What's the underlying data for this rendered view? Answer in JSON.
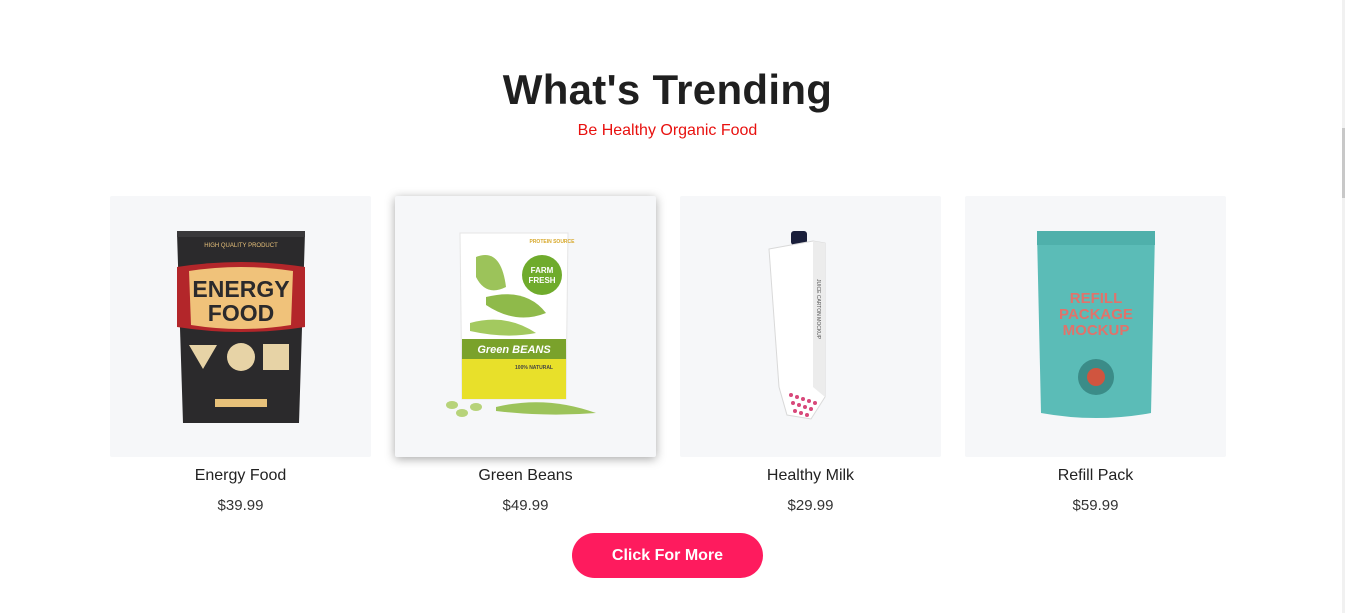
{
  "section": {
    "title": "What's Trending",
    "subtitle": "Be Healthy Organic Food"
  },
  "products": [
    {
      "name": "Energy Food",
      "price": "$39.99",
      "image_icon": "energy-food-pack-icon"
    },
    {
      "name": "Green Beans",
      "price": "$49.99",
      "image_icon": "green-beans-pouch-icon"
    },
    {
      "name": "Healthy Milk",
      "price": "$29.99",
      "image_icon": "milk-carton-icon"
    },
    {
      "name": "Refill Pack",
      "price": "$59.99",
      "image_icon": "refill-pouch-icon"
    }
  ],
  "packaging_text": {
    "energy_brand": "ENERGY",
    "energy_brand_2": "FOOD",
    "energy_tagline": "HIGH QUALITY PRODUCT",
    "beans_badge_1": "FARM",
    "beans_badge_2": "FRESH",
    "beans_label": "Green BEANS",
    "beans_natural": "100% NATURAL",
    "beans_protein": "PROTEIN SOURCE",
    "milk_side": "JUICE CARTON MOCKUP",
    "refill_1": "REFILL",
    "refill_2": "PACKAGE",
    "refill_3": "MOCKUP"
  },
  "cta": {
    "label": "Click For More"
  },
  "colors": {
    "accent": "#fe1b5e",
    "subtitle": "#e8110f",
    "card_bg": "#f6f7f9"
  }
}
